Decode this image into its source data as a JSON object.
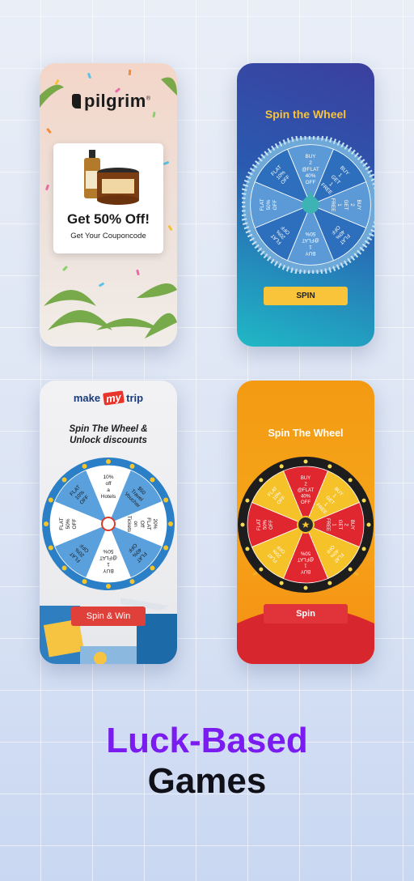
{
  "cards": {
    "pilgrim": {
      "brand": "pilgrim",
      "trademark": "®",
      "headline": "Get 50% Off!",
      "subtext": "Get Your Couponcode"
    },
    "blue_wheel": {
      "title": "Spin the Wheel",
      "button_label": "SPIN",
      "segments": [
        "BUY 2 @FLAT 40% OFF",
        "BUY 1 GET 1 FREE",
        "BUY 2 GET 1 FREE",
        "FLAT 40% OFF",
        "BUY 1 @FLAT 50%",
        "FLAT 20% OFF",
        "FLAT 50% OFF",
        "FLAT 10% OFF"
      ],
      "colors": {
        "accent": "#f9c33a",
        "title": "#f9c33a"
      }
    },
    "makemytrip": {
      "logo_left": "make",
      "logo_my": "my",
      "logo_right": "trip",
      "title_line1": "Spin The Wheel &",
      "title_line2": "Unlock discounts",
      "button_label": "Spin & Win",
      "segments": [
        "10% off a Hotels",
        "$50 Travel Voucher",
        "20% FLAT Off on Tickets",
        "FLAT 40% OFF",
        "BUY 1 @FLAT 50%",
        "FLAT 20% OFF",
        "FLAT 50% OFF",
        "FLAT 10% OFF"
      ]
    },
    "orange_wheel": {
      "title": "Spin The Wheel",
      "button_label": "Spin",
      "segments": [
        "BUY 2 @FLAT 40% OFF",
        "BUY 1 GET 1 FREE",
        "BUY 2 GET 1 FREE",
        "FLAT 40% OFF",
        "BUY 1 @FLAT 50%",
        "FLAT 20% OFF",
        "FLAT 50% OFF",
        "FLAT 10% OFF"
      ]
    }
  },
  "heading": {
    "line1": "Luck-Based",
    "line2": "Games"
  }
}
